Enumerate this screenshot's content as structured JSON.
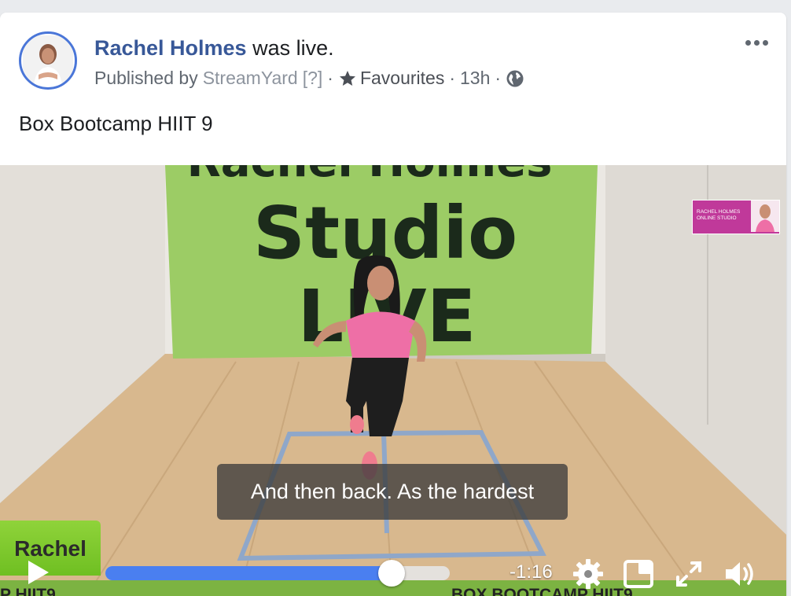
{
  "post": {
    "author": "Rachel Holmes",
    "status": " was live.",
    "published_by_prefix": "Published by",
    "publisher": "StreamYard",
    "help_mark": "[?]",
    "separator": "·",
    "audience_list": "Favourites",
    "time_ago": "13h",
    "text": "Box Bootcamp HIIT 9",
    "more_icon": "more-horizontal-icon",
    "audience_icon": "globe-icon"
  },
  "video": {
    "banner_line1": "Studio",
    "banner_line2": "LIVE",
    "logo_text": "RACHEL HOLMES ONLINE STUDIO",
    "caption": "And then back. As the hardest",
    "name_tag": "Rachel",
    "ticker_left": "P HIIT9",
    "ticker_right": "BOX BOOTCAMP HIIT9",
    "controls": {
      "remaining_time": "-1:16",
      "progress_fraction": 0.83,
      "play_icon": "play-icon",
      "settings_icon": "gear-icon",
      "pip_icon": "picture-in-picture-icon",
      "fullscreen_icon": "fullscreen-icon",
      "volume_icon": "volume-icon"
    }
  },
  "colors": {
    "name_link": "#385898",
    "progress_fill": "#4a7ff0",
    "banner_green": "#9ccc65",
    "name_tag_green": "#7cb342",
    "avatar_ring": "#4a76d8"
  }
}
